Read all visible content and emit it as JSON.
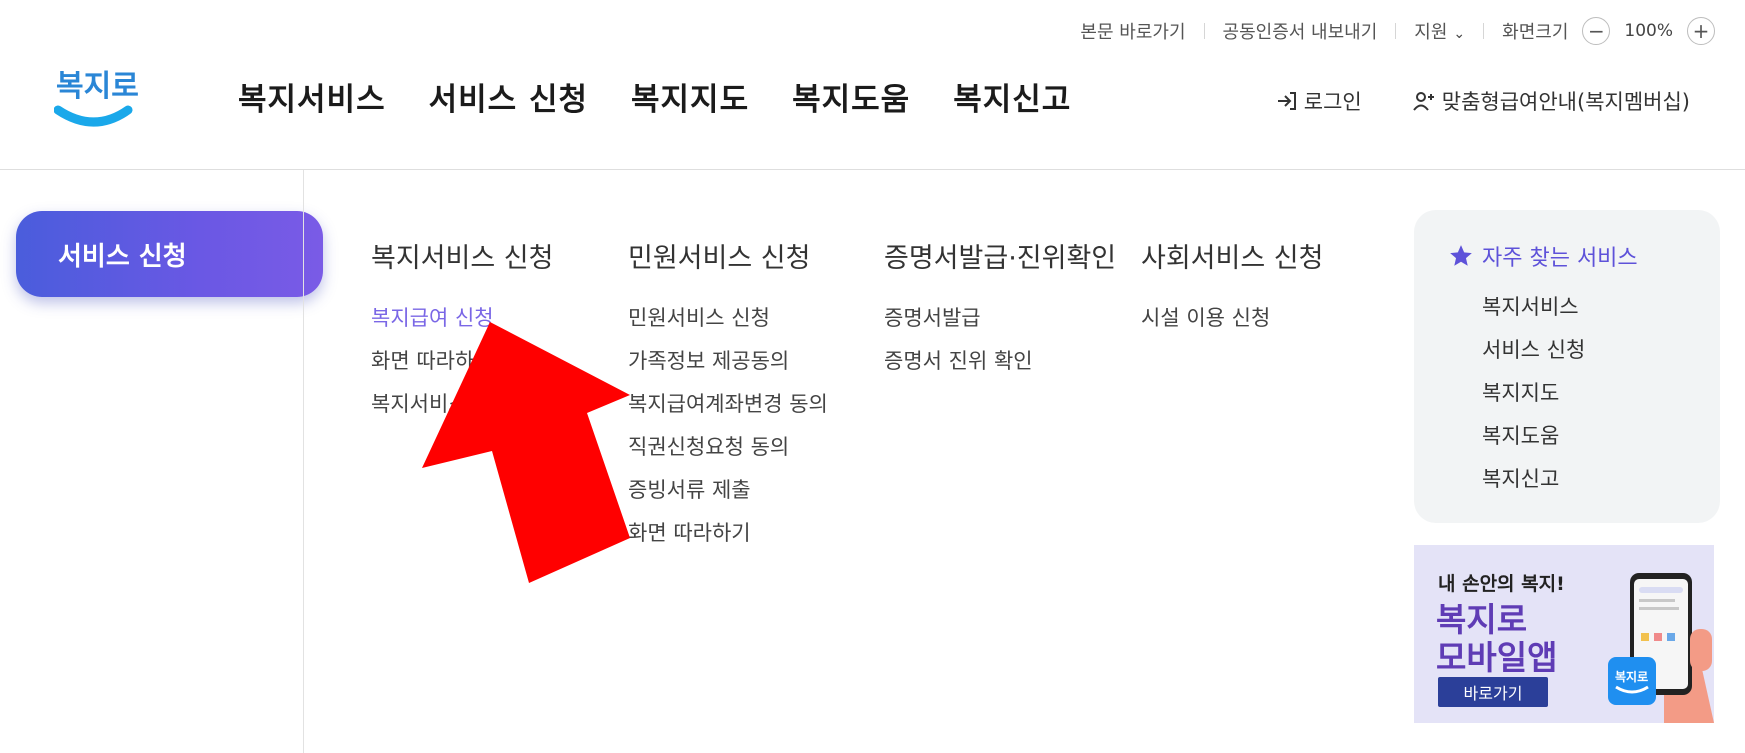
{
  "util": {
    "skip": "본문 바로가기",
    "cert": "공동인증서 내보내기",
    "support": "지원",
    "screen_size": "화면크기",
    "zoom": "100%",
    "zoom_minus": "−",
    "zoom_plus": "+"
  },
  "logo": {
    "text": "복지로"
  },
  "gnb": [
    "복지서비스",
    "서비스 신청",
    "복지지도",
    "복지도움",
    "복지신고"
  ],
  "member": {
    "login": "로그인",
    "membership": "맞춤형급여안내(복지멤버십)"
  },
  "sidebar": {
    "active": "서비스 신청"
  },
  "menu": [
    {
      "title": "복지서비스 신청",
      "links": [
        "복지급여 신청",
        "화면 따라하기",
        "복지서비스"
      ]
    },
    {
      "title": "민원서비스 신청",
      "links": [
        "민원서비스 신청",
        "가족정보 제공동의",
        "복지급여계좌변경 동의",
        "직권신청요청 동의",
        "증빙서류 제출",
        "화면 따라하기"
      ]
    },
    {
      "title": "증명서발급·진위확인",
      "links": [
        "증명서발급",
        "증명서 진위 확인"
      ]
    },
    {
      "title": "사회서비스 신청",
      "links": [
        "시설 이용 신청"
      ]
    }
  ],
  "favorites": {
    "heading": "자주 찾는 서비스",
    "items": [
      "복지서비스",
      "서비스 신청",
      "복지지도",
      "복지도움",
      "복지신고"
    ]
  },
  "banner": {
    "subtitle": "내 손안의 복지!",
    "title_line1": "복지로",
    "title_line2": "모바일앱",
    "button": "바로가기",
    "app_icon_text": "복지로"
  },
  "colors": {
    "accent": "#7a67e6",
    "sidebar_gradient_start": "#4a5ddc",
    "sidebar_gradient_end": "#7a5be6",
    "arrow": "#ff0000"
  }
}
